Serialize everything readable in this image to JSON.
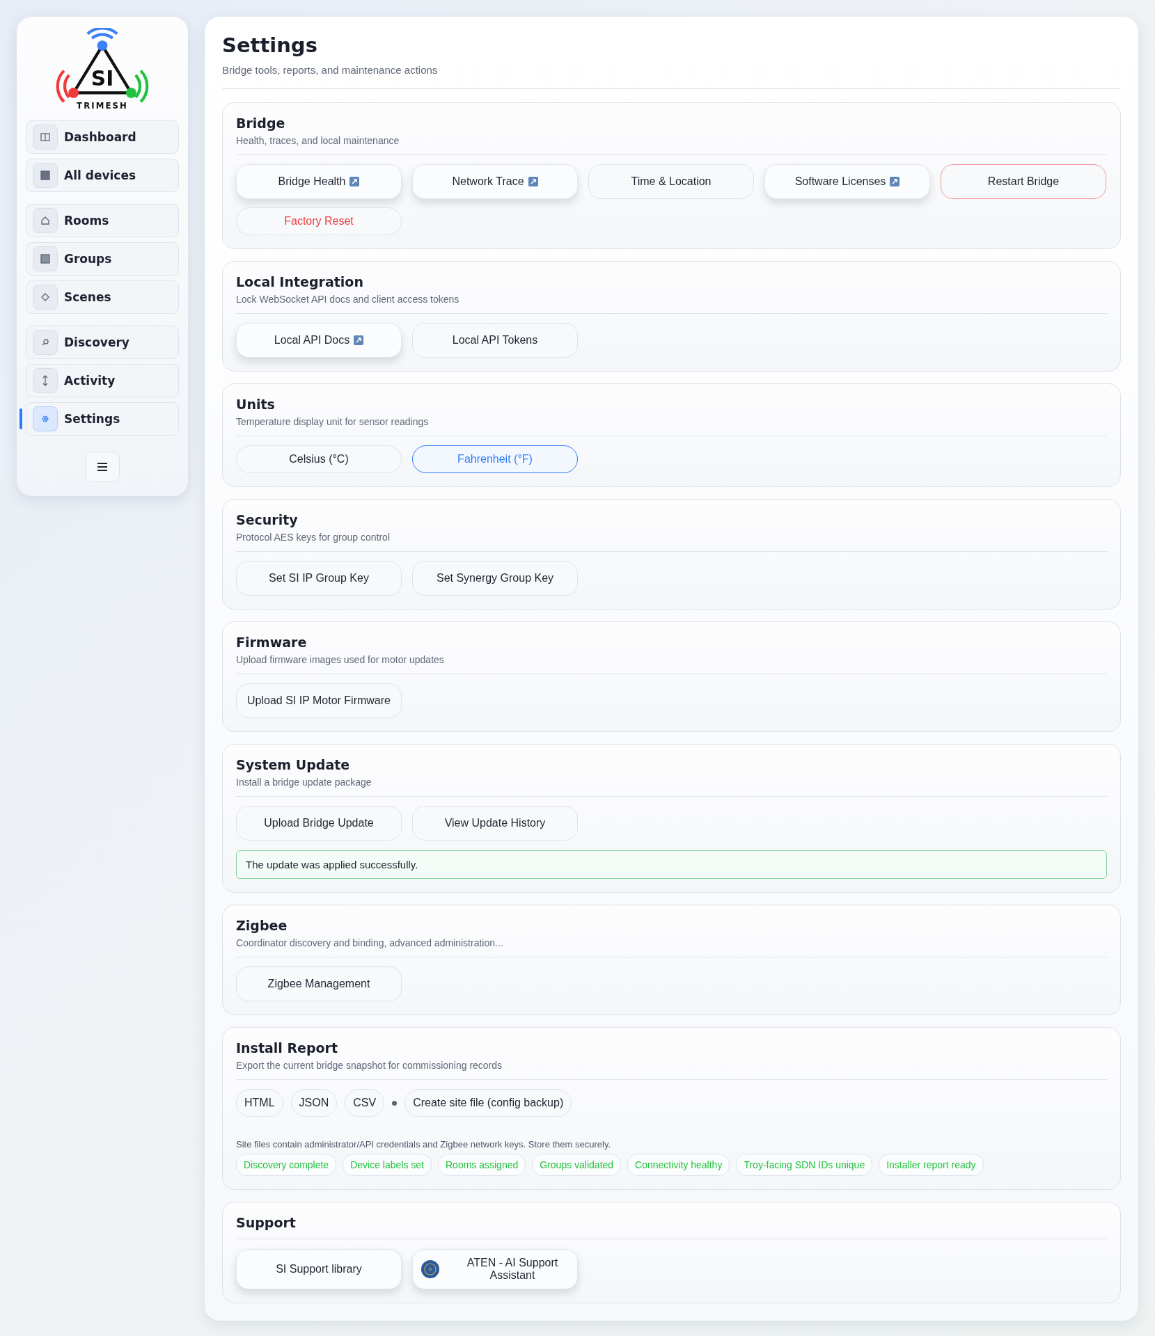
{
  "sidebar": {
    "logo": {
      "letters": "SI",
      "wordmark": "TRIMESH"
    },
    "groups": [
      [
        {
          "label": "Dashboard",
          "selected": false
        },
        {
          "label": "All devices",
          "selected": false
        }
      ],
      [
        {
          "label": "Rooms",
          "selected": false
        },
        {
          "label": "Groups",
          "selected": false
        },
        {
          "label": "Scenes",
          "selected": false
        }
      ],
      [
        {
          "label": "Discovery",
          "selected": false
        },
        {
          "label": "Activity",
          "selected": false
        },
        {
          "label": "Settings",
          "selected": true
        }
      ]
    ]
  },
  "header": {
    "title": "Settings",
    "subtitle": "Bridge tools, reports, and maintenance actions"
  },
  "sections": [
    {
      "title": "Bridge",
      "subtitle": "Health, traces, and local maintenance",
      "buttons": [
        {
          "label": "Bridge Health",
          "kind": "raised",
          "external": true
        },
        {
          "label": "Network Trace",
          "kind": "raised",
          "external": true
        },
        {
          "label": "Time & Location",
          "kind": "plain",
          "external": false
        },
        {
          "label": "Software Licenses",
          "kind": "raised",
          "external": true
        },
        {
          "label": "Restart Bridge",
          "kind": "danger",
          "external": false
        },
        {
          "label": "Factory Reset",
          "kind": "danger-text",
          "external": false
        }
      ]
    },
    {
      "title": "Local Integration",
      "subtitle": "Lock WebSocket API docs and client access tokens",
      "buttons": [
        {
          "label": "Local API Docs",
          "kind": "raised",
          "external": true
        },
        {
          "label": "Local API Tokens",
          "kind": "plain",
          "external": false
        }
      ]
    },
    {
      "title": "Units",
      "subtitle": "Temperature display unit for sensor readings",
      "buttons": [
        {
          "label": "Celsius (°C)",
          "kind": "choice",
          "selected": false
        },
        {
          "label": "Fahrenheit (°F)",
          "kind": "choice",
          "selected": true
        }
      ]
    },
    {
      "title": "Security",
      "subtitle": "Protocol AES keys for group control",
      "buttons": [
        {
          "label": "Set SI IP Group Key",
          "kind": "plain"
        },
        {
          "label": "Set Synergy Group Key",
          "kind": "plain"
        }
      ]
    },
    {
      "title": "Firmware",
      "subtitle": "Upload firmware images used for motor updates",
      "buttons": [
        {
          "label": "Upload SI IP Motor Firmware",
          "kind": "plain"
        }
      ]
    },
    {
      "title": "System Update",
      "subtitle": "Install a bridge update package",
      "buttons": [
        {
          "label": "Upload Bridge Update",
          "kind": "plain"
        },
        {
          "label": "View Update History",
          "kind": "plain"
        }
      ],
      "status": "The update was applied successfully."
    },
    {
      "title": "Zigbee",
      "subtitle": "Coordinator discovery and binding, advanced administration...",
      "buttons": [
        {
          "label": "Zigbee Management",
          "kind": "plain"
        }
      ]
    },
    {
      "title": "Install Report",
      "subtitle": "Export the current bridge snapshot for commissioning records",
      "formats": [
        "HTML",
        "JSON",
        "CSV"
      ],
      "backup": "Create site file (config backup)",
      "note": "Site files contain administrator/API credentials and Zigbee network keys. Store them securely.",
      "checks": [
        "Discovery complete",
        "Device labels set",
        "Rooms assigned",
        "Groups validated",
        "Connectivity healthy",
        "Troy-facing SDN IDs unique",
        "Installer report ready"
      ]
    },
    {
      "title": "Support",
      "buttons": [
        {
          "label": "SI Support library",
          "kind": "raised"
        },
        {
          "label": "ATEN - AI Support Assistant",
          "kind": "raised",
          "avatar": true
        }
      ]
    }
  ]
}
